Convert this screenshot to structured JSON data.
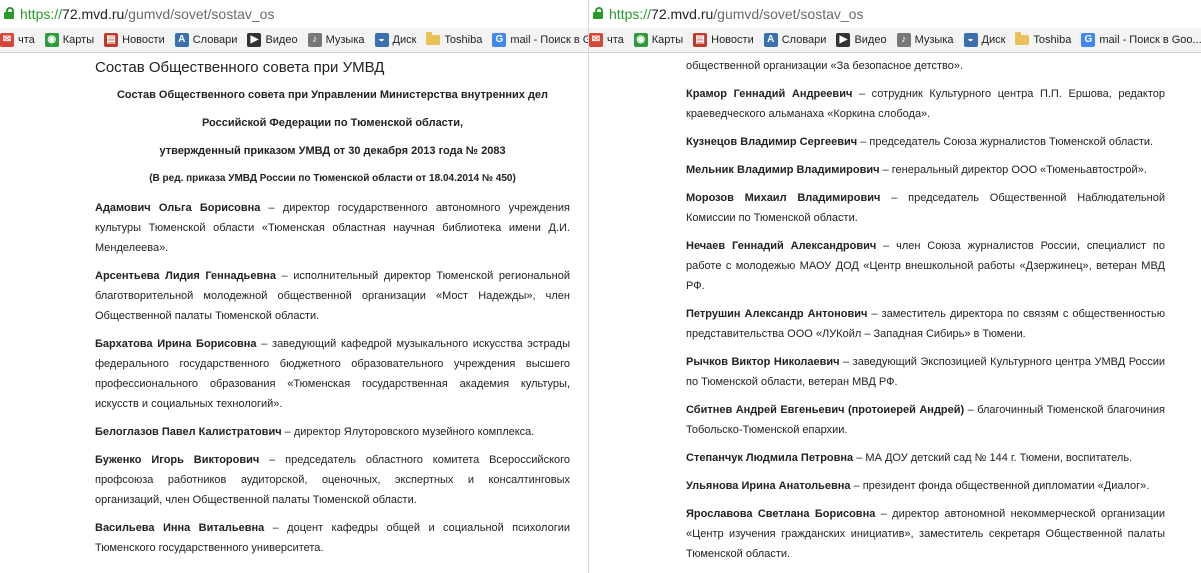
{
  "browser": {
    "url_prefix": "https://",
    "url_host": "72.mvd.ru",
    "url_path": "/gumvd/sovet/sostav_os",
    "bookmarks_left": [
      {
        "label": "чта",
        "icon": "mail-icon"
      },
      {
        "label": "Карты",
        "icon": "maps-icon"
      },
      {
        "label": "Новости",
        "icon": "news-icon"
      },
      {
        "label": "Словари",
        "icon": "dictionary-icon"
      },
      {
        "label": "Видео",
        "icon": "video-icon"
      },
      {
        "label": "Музыка",
        "icon": "music-icon"
      },
      {
        "label": "Диск",
        "icon": "disk-icon"
      },
      {
        "label": "Toshiba",
        "icon": "folder-icon"
      },
      {
        "label": "mail - Поиск в Goo...",
        "icon": "google-icon"
      }
    ],
    "bookmarks_right": [
      {
        "label": "чта",
        "icon": "mail-icon"
      },
      {
        "label": "Карты",
        "icon": "maps-icon"
      },
      {
        "label": "Новости",
        "icon": "news-icon"
      },
      {
        "label": "Словари",
        "icon": "dictionary-icon"
      },
      {
        "label": "Видео",
        "icon": "video-icon"
      },
      {
        "label": "Музыка",
        "icon": "music-icon"
      },
      {
        "label": "Диск",
        "icon": "disk-icon"
      },
      {
        "label": "Toshiba",
        "icon": "folder-icon"
      },
      {
        "label": "mail - Поиск в Goo...",
        "icon": "google-icon"
      }
    ]
  },
  "left": {
    "page_title": "Состав Общественного совета при УМВД",
    "sub1": "Состав Общественного совета при Управлении Министерства внутренних дел",
    "sub2": "Российской Федерации по Тюменской области,",
    "sub3": "утвержденный приказом УМВД от 30 декабря 2013 года № 2083",
    "sub4": "(В ред. приказа УМВД России по Тюменской области от 18.04.2014 № 450)",
    "entries": [
      {
        "name": "Адамович Ольга Борисовна",
        "desc": " – директор государственного автономного учреждения культуры Тюменской области «Тюменская областная научная библиотека имени Д.И. Менделеева»."
      },
      {
        "name": "Арсентьева Лидия Геннадьевна",
        "desc": " – исполнительный директор Тюменской региональной благотворительной молодежной общественной организации «Мост Надежды», член Общественной палаты Тюменской области."
      },
      {
        "name": "Бархатова Ирина Борисовна",
        "desc": " – заведующий кафедрой музыкального искусства эстрады федерального государственного бюджетного образовательного учреждения высшего профессионального образования «Тюменская государственная академия культуры, искусств и социальных технологий»."
      },
      {
        "name": "Белоглазов Павел Калистратович",
        "desc": " – директор Ялуторовского музейного комплекса."
      },
      {
        "name": "Буженко Игорь Викторович",
        "desc": " – председатель областного комитета Всероссийского профсоюза работников аудиторской, оценочных, экспертных и консалтинговых организаций, член Общественной палаты Тюменской области."
      },
      {
        "name": "Васильева Инна Витальевна",
        "desc": " – доцент кафедры общей и социальной психологии Тюменского государственного университета."
      }
    ]
  },
  "right": {
    "top_fragment": "общественной организации «За безопасное детство».",
    "entries": [
      {
        "name": "Крамор Геннадий Андреевич",
        "desc": " – сотрудник Культурного центра П.П. Ершова, редактор краеведческого альманаха «Коркина слобода»."
      },
      {
        "name": "Кузнецов Владимир Сергеевич",
        "desc": " – председатель Союза журналистов Тюменской области."
      },
      {
        "name": "Мельник Владимир Владимирович",
        "desc": " – генеральный директор ООО «Тюменьавтострой»."
      },
      {
        "name": "Морозов Михаил Владимирович",
        "desc": " – председатель Общественной Наблюдательной Комиссии по Тюменской области."
      },
      {
        "name": "Нечаев Геннадий Александрович",
        "desc": " – член Союза журналистов России, специалист по работе с молодежью МАОУ ДОД «Центр внешкольной работы «Дзержинец», ветеран МВД РФ."
      },
      {
        "name": "Петрушин Александр Антонович",
        "desc": " – заместитель директора по связям с общественностью представительства ООО «ЛУКойл – Западная Сибирь» в Тюмени."
      },
      {
        "name": "Рычков Виктор Николаевич",
        "desc": " – заведующий Экспозицией Культурного центра УМВД России по Тюменской области, ветеран МВД РФ."
      },
      {
        "name": "Сбитнев Андрей Евгеньевич (протоиерей Андрей)",
        "desc": " – благочинный Тюменской благочиния Тобольско-Тюменской епархии."
      },
      {
        "name": "Степанчук Людмила Петровна",
        "desc": " – МА ДОУ детский сад № 144 г. Тюмени, воспитатель."
      },
      {
        "name": "Ульянова Ирина Анатольевна",
        "desc": " – президент фонда общественной дипломатии «Диалог»."
      },
      {
        "name": "Ярославова Светлана Борисовна",
        "desc": " – директор автономной некоммерческой организации «Центр изучения гражданских инициатив», заместитель секретаря Общественной палаты Тюменской области."
      }
    ]
  },
  "icon_colors": {
    "mail-icon": "#d44638",
    "maps-icon": "#2e9b3c",
    "news-icon": "#c0392b",
    "dictionary-icon": "#3a6fb0",
    "video-icon": "#333333",
    "music-icon": "#777777",
    "disk-icon": "#3a6fb0",
    "google-icon": "#4285f4"
  }
}
